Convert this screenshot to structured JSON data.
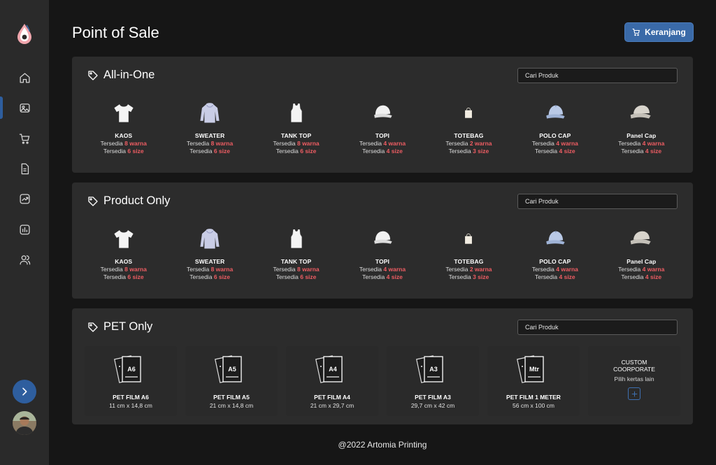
{
  "header": {
    "title": "Point of Sale",
    "cart_label": "Keranjang"
  },
  "sidebar": {
    "items": [
      {
        "icon": "home-icon"
      },
      {
        "icon": "image-icon"
      },
      {
        "icon": "cart-icon"
      },
      {
        "icon": "document-icon"
      },
      {
        "icon": "trend-chart-icon"
      },
      {
        "icon": "bar-chart-icon"
      },
      {
        "icon": "users-icon"
      }
    ],
    "active_index": 1
  },
  "sections": [
    {
      "title": "All-in-One",
      "search_placeholder": "Cari Produk",
      "products": [
        {
          "name": "KAOS",
          "prefix": "Tersedia",
          "line1_value": "8 warna",
          "line2_value": "6 size"
        },
        {
          "name": "SWEATER",
          "prefix": "Tersedia",
          "line1_value": "8 warna",
          "line2_value": "6 size"
        },
        {
          "name": "TANK TOP",
          "prefix": "Tersedia",
          "line1_value": "8 warna",
          "line2_value": "6 size"
        },
        {
          "name": "TOPI",
          "prefix": "Tersedia",
          "line1_value": "4 warna",
          "line2_value": "4 size"
        },
        {
          "name": "TOTEBAG",
          "prefix": "Tersedia",
          "line1_value": "2 warna",
          "line2_value": "3 size"
        },
        {
          "name": "POLO CAP",
          "prefix": "Tersedia",
          "line1_value": "4 warna",
          "line2_value": "4 size"
        },
        {
          "name": "Panel Cap",
          "prefix": "Tersedia",
          "line1_value": "4 warna",
          "line2_value": "4 size"
        }
      ]
    },
    {
      "title": "Product Only",
      "search_placeholder": "Cari Produk",
      "products": [
        {
          "name": "KAOS",
          "prefix": "Tersedia",
          "line1_value": "8 warna",
          "line2_value": "6 size"
        },
        {
          "name": "SWEATER",
          "prefix": "Tersedia",
          "line1_value": "8 warna",
          "line2_value": "6 size"
        },
        {
          "name": "TANK TOP",
          "prefix": "Tersedia",
          "line1_value": "8 warna",
          "line2_value": "6 size"
        },
        {
          "name": "TOPI",
          "prefix": "Tersedia",
          "line1_value": "4 warna",
          "line2_value": "4 size"
        },
        {
          "name": "TOTEBAG",
          "prefix": "Tersedia",
          "line1_value": "2 warna",
          "line2_value": "3 size"
        },
        {
          "name": "POLO CAP",
          "prefix": "Tersedia",
          "line1_value": "4 warna",
          "line2_value": "4 size"
        },
        {
          "name": "Panel Cap",
          "prefix": "Tersedia",
          "line1_value": "4 warna",
          "line2_value": "4 size"
        }
      ]
    },
    {
      "title": "PET Only",
      "search_placeholder": "Cari Produk",
      "films": [
        {
          "badge": "A6",
          "name": "PET FILM A6",
          "size": "11 cm x 14,8 cm"
        },
        {
          "badge": "A5",
          "name": "PET FILM A5",
          "size": "21 cm x 14,8 cm"
        },
        {
          "badge": "A4",
          "name": "PET FILM A4",
          "size": "21 cm x 29,7 cm"
        },
        {
          "badge": "A3",
          "name": "PET FILM A3",
          "size": "29,7 cm x 42 cm"
        },
        {
          "badge": "Mtr",
          "name": "PET FILM 1 METER",
          "size": "56 cm x 100 cm"
        }
      ],
      "custom": {
        "title": "CUSTOM COORPORATE",
        "subtitle": "Pilih kertas lain"
      }
    }
  ],
  "footer": "@2022 Artomia Printing",
  "colors": {
    "accent": "#2e5e9e",
    "highlight": "#ef5d63",
    "panel": "#2c2c2c",
    "background": "#161616"
  }
}
